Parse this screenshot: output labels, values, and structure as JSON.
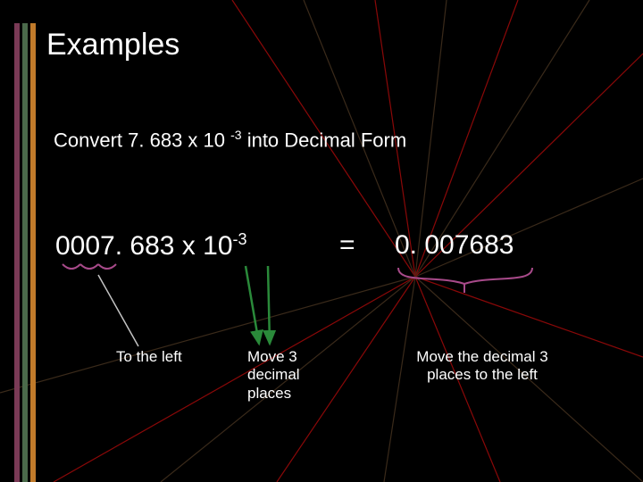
{
  "title": "Examples",
  "subtitle_prefix": "Convert 7. 683 x 10 ",
  "subtitle_exp": "-3",
  "subtitle_suffix": " into Decimal Form",
  "expr_left_prefix": "0007. 683 x 10",
  "expr_left_exp": "-3",
  "equals": "=",
  "expr_right": "0. 007683",
  "ann_left": "To the left",
  "ann_mid": "Move 3 decimal places",
  "ann_right": "Move the decimal 3 places to the left",
  "colors": {
    "arrow_green": "#2a8a3a",
    "line_red": "#8a0808",
    "line_dull": "#3a2a1a",
    "brace": "#a84a8a"
  }
}
